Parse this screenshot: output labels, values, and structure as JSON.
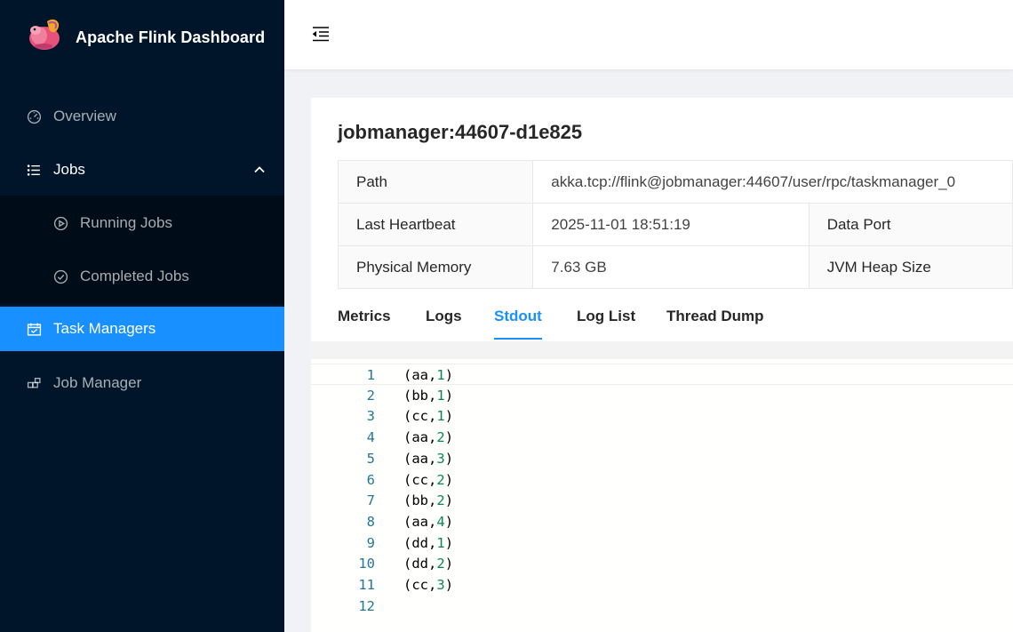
{
  "app": {
    "title": "Apache Flink Dashboard"
  },
  "sidebar": {
    "items": [
      {
        "label": "Overview",
        "icon": "dashboard-icon"
      },
      {
        "label": "Jobs",
        "icon": "unordered-list-icon",
        "expanded": true,
        "children": [
          {
            "label": "Running Jobs",
            "icon": "play-circle-icon"
          },
          {
            "label": "Completed Jobs",
            "icon": "check-circle-icon"
          }
        ]
      },
      {
        "label": "Task Managers",
        "icon": "schedule-icon",
        "active": true
      },
      {
        "label": "Job Manager",
        "icon": "build-icon"
      }
    ]
  },
  "header": {
    "fold_icon": "menu-fold-icon"
  },
  "taskmanager": {
    "title": "jobmanager:44607-d1e825",
    "details": {
      "path_label": "Path",
      "path_value": "akka.tcp://flink@jobmanager:44607/user/rpc/taskmanager_0",
      "heartbeat_label": "Last Heartbeat",
      "heartbeat_value": "2025-11-01 18:51:19",
      "data_port_label": "Data Port",
      "memory_label": "Physical Memory",
      "memory_value": "7.63 GB",
      "jvm_heap_label": "JVM Heap Size"
    },
    "tabs": [
      "Metrics",
      "Logs",
      "Stdout",
      "Log List",
      "Thread Dump"
    ],
    "active_tab": "Stdout"
  },
  "stdout": {
    "lines": [
      {
        "n": "1",
        "key": "aa",
        "count": "1"
      },
      {
        "n": "2",
        "key": "bb",
        "count": "1"
      },
      {
        "n": "3",
        "key": "cc",
        "count": "1"
      },
      {
        "n": "4",
        "key": "aa",
        "count": "2"
      },
      {
        "n": "5",
        "key": "aa",
        "count": "3"
      },
      {
        "n": "6",
        "key": "cc",
        "count": "2"
      },
      {
        "n": "7",
        "key": "bb",
        "count": "2"
      },
      {
        "n": "8",
        "key": "aa",
        "count": "4"
      },
      {
        "n": "9",
        "key": "dd",
        "count": "1"
      },
      {
        "n": "10",
        "key": "dd",
        "count": "2"
      },
      {
        "n": "11",
        "key": "cc",
        "count": "3"
      },
      {
        "n": "12",
        "key": "",
        "count": ""
      }
    ]
  },
  "colors": {
    "sider": "#001529",
    "submenu": "#000c17",
    "primary": "#1890ff",
    "line_number": "#237893",
    "number_token": "#098658"
  }
}
